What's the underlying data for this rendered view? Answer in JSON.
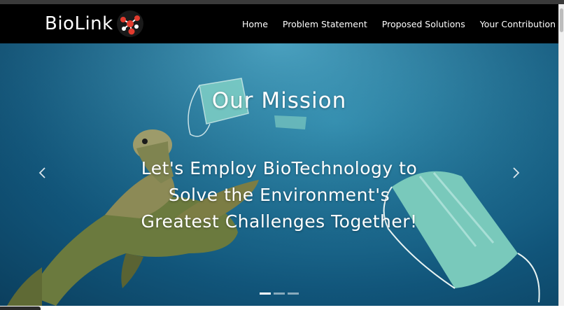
{
  "brand": {
    "name": "BioLink",
    "logo_icon": "molecule-logo-icon",
    "logo_colors": [
      "#e23b2e",
      "#ffffff"
    ]
  },
  "nav": {
    "items": [
      {
        "label": "Home"
      },
      {
        "label": "Problem Statement"
      },
      {
        "label": "Proposed Solutions"
      },
      {
        "label": "Your Contribution"
      }
    ]
  },
  "carousel": {
    "title": "Our Mission",
    "subtitle_lines": [
      "Let's Employ BioTechnology to",
      "Solve the Environment's",
      "Greatest Challenges Together!"
    ],
    "prev_icon": "chevron-left-icon",
    "next_icon": "chevron-right-icon",
    "slide_count": 3,
    "active_slide": 1
  },
  "colors": {
    "navbar": "#000000",
    "ocean": "#1f6f93",
    "text": "#ffffff"
  }
}
